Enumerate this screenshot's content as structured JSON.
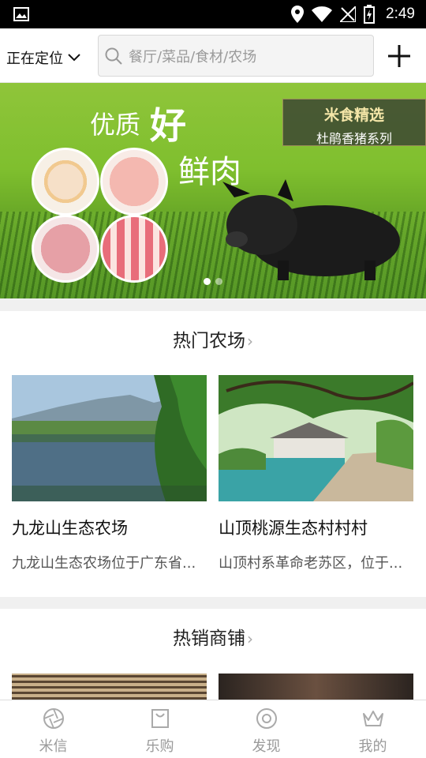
{
  "status_bar": {
    "time": "2:49"
  },
  "header": {
    "location_label": "正在定位",
    "search_placeholder": "餐厅/菜品/食材/农场"
  },
  "banner": {
    "headline_part1": "优质",
    "headline_part2": "好",
    "headline_part3": "鲜肉",
    "tag_title": "米食精选",
    "tag_subtitle": "杜鹃香猪系列",
    "page_count": 2,
    "active_page": 1
  },
  "hot_farms": {
    "title": "热门农场",
    "items": [
      {
        "name": "九龙山生态农场",
        "desc": "九龙山生态农场位于广东省..."
      },
      {
        "name": "山顶桃源生态村村村",
        "desc": "山顶村系革命老苏区，位于..."
      }
    ]
  },
  "hot_shops": {
    "title": "热销商铺"
  },
  "tabbar": {
    "tabs": [
      {
        "label": "米信",
        "icon": "aperture-icon"
      },
      {
        "label": "乐购",
        "icon": "shopping-bag-icon"
      },
      {
        "label": "发现",
        "icon": "discover-icon"
      },
      {
        "label": "我的",
        "icon": "crown-icon"
      }
    ]
  }
}
